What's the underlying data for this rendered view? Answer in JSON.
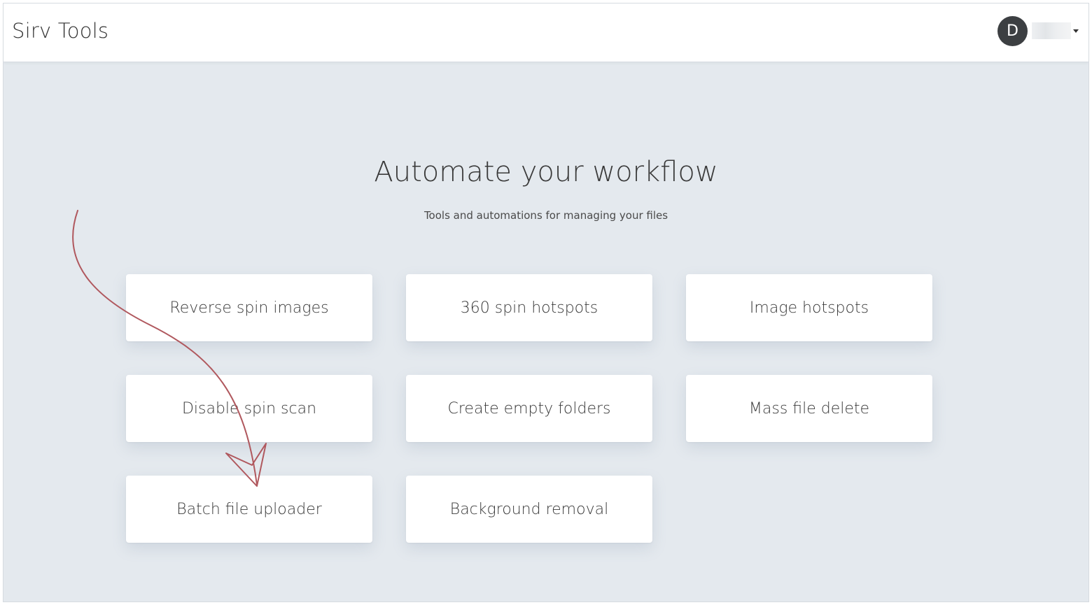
{
  "header": {
    "brand": "Sirv Tools",
    "user": {
      "avatar_initial": "D"
    }
  },
  "hero": {
    "title": "Automate your workflow",
    "subtitle": "Tools and automations for managing your files"
  },
  "tools": [
    {
      "label": "Reverse spin images"
    },
    {
      "label": "360 spin hotspots"
    },
    {
      "label": "Image hotspots"
    },
    {
      "label": "Disable spin scan"
    },
    {
      "label": "Create empty folders"
    },
    {
      "label": "Mass file delete"
    },
    {
      "label": "Batch file uploader"
    },
    {
      "label": "Background removal"
    }
  ],
  "colors": {
    "background": "#e4e9ee",
    "card": "#ffffff",
    "avatar": "#3c3f42",
    "annotation_arrow": "#b0585e"
  },
  "annotation": {
    "icon": "curved-arrow-icon",
    "points_to": "Batch file uploader"
  }
}
